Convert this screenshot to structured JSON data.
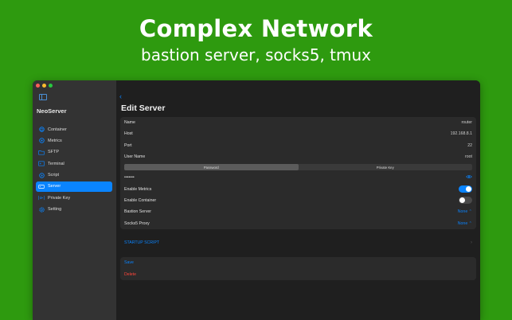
{
  "hero": {
    "title": "Complex Network",
    "subtitle": "bastion server, socks5, tmux"
  },
  "window": {
    "traffic_colors": [
      "#ff5f57",
      "#febc2e",
      "#28c840"
    ]
  },
  "sidebar": {
    "app_name": "NeoServer",
    "items": [
      {
        "label": "Container",
        "icon": "cube-icon"
      },
      {
        "label": "Metrics",
        "icon": "gauge-icon"
      },
      {
        "label": "SFTP",
        "icon": "folder-icon"
      },
      {
        "label": "Terminal",
        "icon": "terminal-icon"
      },
      {
        "label": "Script",
        "icon": "script-icon"
      },
      {
        "label": "Server",
        "icon": "server-icon",
        "active": true
      },
      {
        "label": "Private Key",
        "icon": "key-icon"
      },
      {
        "label": "Setting",
        "icon": "gear-icon"
      }
    ]
  },
  "main": {
    "back_icon": "chevron-left-icon",
    "title": "Edit Server",
    "fields": {
      "name_label": "Name",
      "name_value": "router",
      "host_label": "Host",
      "host_value": "192.168.8.1",
      "port_label": "Port",
      "port_value": "22",
      "user_label": "User Name",
      "user_value": "root"
    },
    "auth_tabs": {
      "password": "Password",
      "private_key": "Private Key",
      "selected": "Password"
    },
    "password_value": "•••••••",
    "enable_metrics": {
      "label": "Enable Metrics",
      "on": true
    },
    "enable_container": {
      "label": "Enable Container",
      "on": false
    },
    "bastion": {
      "label": "Bastion Server",
      "value": "None ⌃"
    },
    "socks5": {
      "label": "Socks5 Proxy",
      "value": "None ⌃"
    },
    "startup_script": "STARTUP SCRIPT",
    "save": "Save",
    "delete": "Delete"
  },
  "colors": {
    "accent": "#0a84ff",
    "danger": "#ff453a",
    "background": "#2e9a0f"
  }
}
